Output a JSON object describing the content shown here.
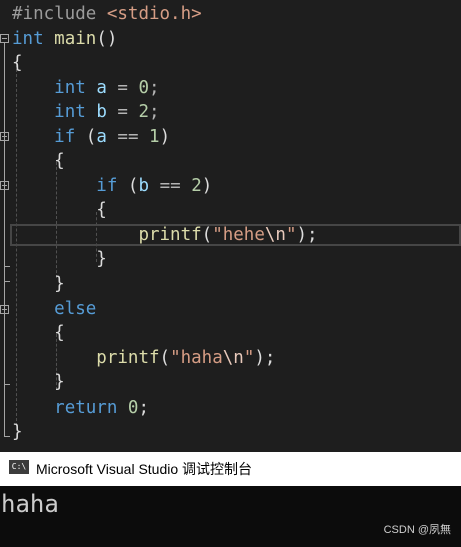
{
  "editor": {
    "include_directive": "#include",
    "include_header": "<stdio.h>",
    "kw_int": "int",
    "fn_main": "main",
    "main_parens": "()",
    "brace_open": "{",
    "brace_close": "}",
    "var_a": "a",
    "var_b": "b",
    "assign": "=",
    "semicolon": ";",
    "val_0": "0",
    "val_2": "2",
    "kw_if": "if",
    "kw_else": "else",
    "kw_return": "return",
    "paren_open": "(",
    "paren_close": ")",
    "eq": "==",
    "val_1": "1",
    "fn_printf": "printf",
    "str_hehe": "\"hehe",
    "str_haha": "\"haha",
    "esc_n": "\\n",
    "quote_close": "\"",
    "close_call": ");"
  },
  "console": {
    "icon_label": "C:\\",
    "title": "Microsoft Visual Studio 调试控制台",
    "output": "haha"
  },
  "watermark": "CSDN @夙無"
}
